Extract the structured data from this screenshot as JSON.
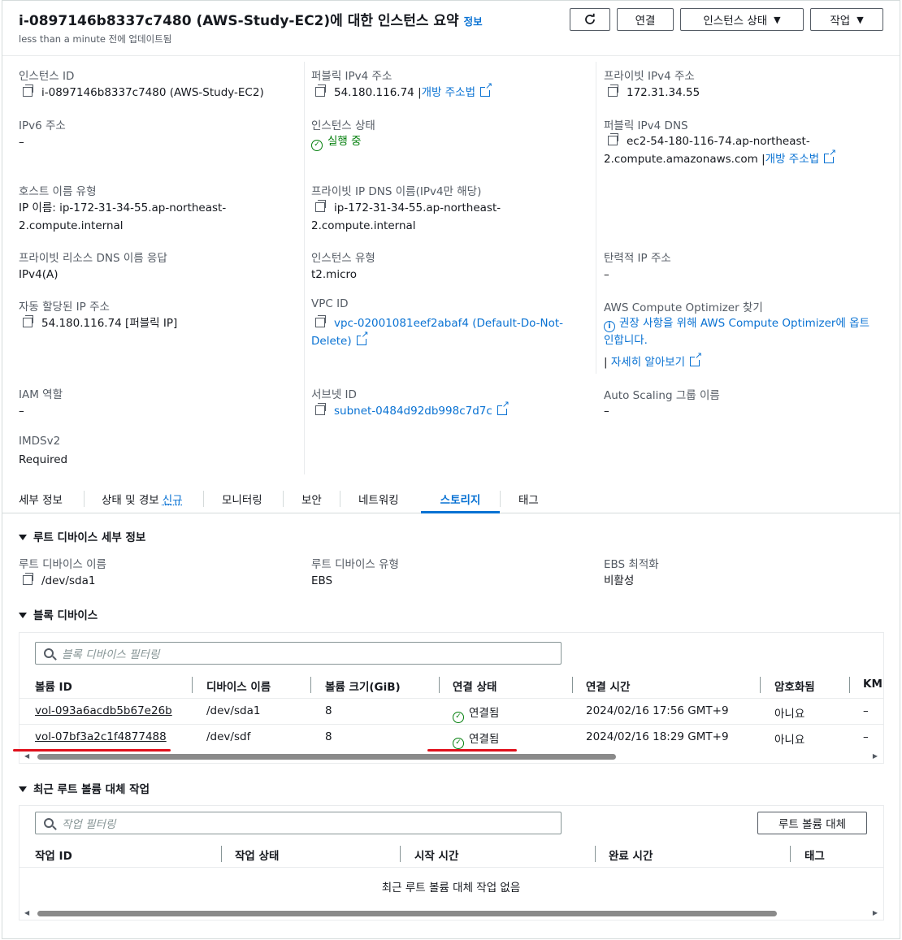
{
  "header": {
    "title": "i-0897146b8337c7480 (AWS-Study-EC2)에 대한 인스턴스 요약",
    "info_link": "정보",
    "subtitle": "less than a minute 전에 업데이트됨",
    "buttons": {
      "refresh": "",
      "connect": "연결",
      "instance_state": "인스턴스 상태",
      "actions": "작업"
    }
  },
  "summary": {
    "instance_id": {
      "label": "인스턴스 ID",
      "value": "i-0897146b8337c7480 (AWS-Study-EC2)"
    },
    "public_ipv4": {
      "label": "퍼블릭 IPv4 주소",
      "value": "54.180.116.74",
      "sep": "|",
      "link": "개방 주소법"
    },
    "private_ipv4": {
      "label": "프라이빗 IPv4 주소",
      "value": "172.31.34.55"
    },
    "ipv6": {
      "label": "IPv6 주소",
      "value": "–"
    },
    "instance_state": {
      "label": "인스턴스 상태",
      "value": "실행 중"
    },
    "public_dns": {
      "label": "퍼블릭 IPv4 DNS",
      "line1": "ec2-54-180-116-74.ap-northeast-",
      "line2": "2.compute.amazonaws.com",
      "sep": "|",
      "link": "개방 주소법"
    },
    "hostname_type": {
      "label": "호스트 이름 유형",
      "line1": "IP 이름: ip-172-31-34-55.ap-northeast-",
      "line2": "2.compute.internal"
    },
    "private_dns": {
      "label": "프라이빗 IP DNS 이름(IPv4만 해당)",
      "line1": "ip-172-31-34-55.ap-northeast-",
      "line2": "2.compute.internal"
    },
    "resource_dns": {
      "label": "프라이빗 리소스 DNS 이름 응답",
      "value": "IPv4(A)"
    },
    "instance_type": {
      "label": "인스턴스 유형",
      "value": "t2.micro"
    },
    "elastic_ip": {
      "label": "탄력적 IP 주소",
      "value": "–"
    },
    "auto_ip": {
      "label": "자동 할당된 IP 주소",
      "value": "54.180.116.74 [퍼블릭 IP]"
    },
    "vpc_id": {
      "label": "VPC ID",
      "line1": "vpc-02001081eef2abaf4 (Default-Do-Not-",
      "line2": "Delete)"
    },
    "optimizer": {
      "label": "AWS Compute Optimizer 찾기",
      "line1": "권장 사항을 위해 AWS Compute Optimizer에 옵트",
      "line2": "인합니다.",
      "sep": "|",
      "link": "자세히 알아보기"
    },
    "iam_role": {
      "label": "IAM 역할",
      "value": "–"
    },
    "subnet_id": {
      "label": "서브넷 ID",
      "value": "subnet-0484d92db998c7d7c"
    },
    "asg_name": {
      "label": "Auto Scaling 그룹 이름",
      "value": "–"
    },
    "imdsv2": {
      "label": "IMDSv2",
      "value": "Required"
    }
  },
  "tabs": [
    {
      "label": "세부 정보"
    },
    {
      "label": "상태 및 경보",
      "badge": "신규"
    },
    {
      "label": "모니터링"
    },
    {
      "label": "보안"
    },
    {
      "label": "네트워킹"
    },
    {
      "label": "스토리지"
    },
    {
      "label": "태그"
    }
  ],
  "active_tab": "스토리지",
  "root_device": {
    "section_title": "루트 디바이스 세부 정보",
    "name_label": "루트 디바이스 이름",
    "name_value": "/dev/sda1",
    "type_label": "루트 디바이스 유형",
    "type_value": "EBS",
    "ebs_opt_label": "EBS 최적화",
    "ebs_opt_value": "비활성"
  },
  "block_devices": {
    "section_title": "블록 디바이스",
    "filter_placeholder": "블록 디바이스 필터링",
    "columns": [
      "볼륨 ID",
      "디바이스 이름",
      "볼륨 크기(GiB)",
      "연결 상태",
      "연결 시간",
      "암호화됨",
      "KMS"
    ],
    "rows": [
      {
        "volume_id": "vol-093a6acdb5b67e26b",
        "device": "/dev/sda1",
        "size": "8",
        "status": "연결됨",
        "time": "2024/02/16 17:56 GMT+9",
        "encrypted": "아니요",
        "kms": "–"
      },
      {
        "volume_id": "vol-07bf3a2c1f4877488",
        "device": "/dev/sdf",
        "size": "8",
        "status": "연결됨",
        "time": "2024/02/16 18:29 GMT+9",
        "encrypted": "아니요",
        "kms": "–"
      }
    ]
  },
  "root_replace": {
    "section_title": "최근 루트 볼륨 대체 작업",
    "filter_placeholder": "작업 필터링",
    "button": "루트 볼륨 대체",
    "columns": [
      "작업 ID",
      "작업 상태",
      "시작 시간",
      "완료 시간",
      "태그"
    ],
    "empty": "최근 루트 볼륨 대체 작업 없음"
  }
}
